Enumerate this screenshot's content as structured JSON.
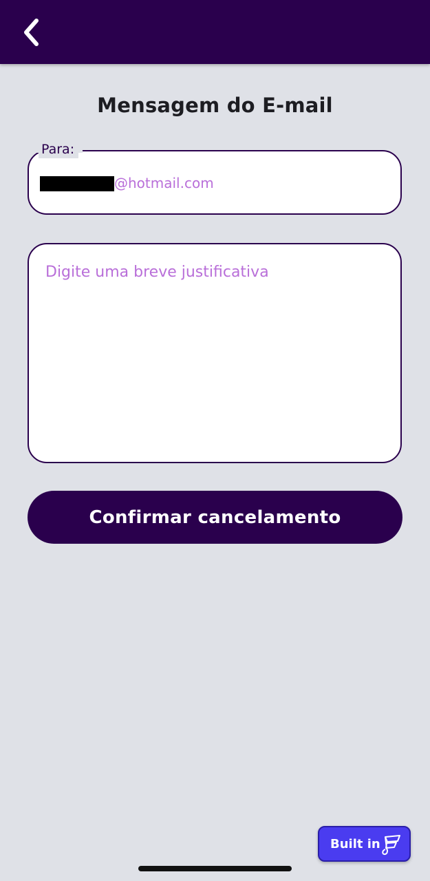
{
  "header": {
    "back_icon": "chevron-left-icon",
    "background_color": "#2a004d"
  },
  "page": {
    "title": "Mensagem do E-mail"
  },
  "to_field": {
    "label": "Para:",
    "value_domain": "@hotmail.com",
    "value_redacted": true
  },
  "message": {
    "placeholder": "Digite uma breve justificativa",
    "value": ""
  },
  "actions": {
    "confirm_label": "Confirmar cancelamento"
  },
  "badge": {
    "label": "Built in",
    "icon": "flutterflow-logo-icon",
    "color": "#4a3cf0"
  },
  "colors": {
    "primary": "#2a004d",
    "background": "#dfe1e7",
    "placeholder": "#b96fd9"
  }
}
